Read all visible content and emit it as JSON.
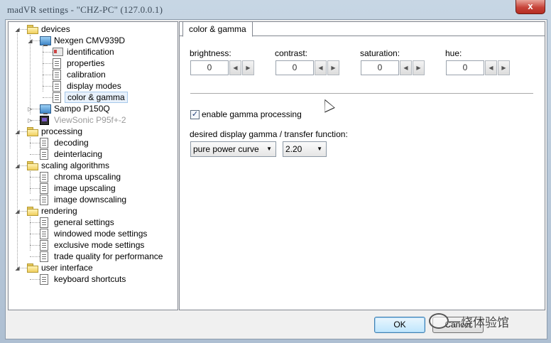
{
  "window": {
    "title": "madVR settings - \"CHZ-PC\" (127.0.0.1)",
    "close_glyph": "x"
  },
  "tree": {
    "items": [
      {
        "label": "devices",
        "icon": "folder-icon",
        "level": 0
      },
      {
        "label": "Nexgen CMV939D",
        "icon": "monitor-icon",
        "level": 1
      },
      {
        "label": "identification",
        "icon": "id-card-icon",
        "level": 2
      },
      {
        "label": "properties",
        "icon": "document-icon",
        "level": 2
      },
      {
        "label": "calibration",
        "icon": "document-icon",
        "level": 2
      },
      {
        "label": "display modes",
        "icon": "document-icon",
        "level": 2
      },
      {
        "label": "color & gamma",
        "icon": "document-icon",
        "level": 2,
        "selected": true
      },
      {
        "label": "Sampo P150Q",
        "icon": "monitor-icon",
        "level": 1
      },
      {
        "label": "ViewSonic P95f+-2",
        "icon": "tv-icon",
        "level": 1,
        "disabled": true
      },
      {
        "label": "processing",
        "icon": "folder-icon",
        "level": 0
      },
      {
        "label": "decoding",
        "icon": "document-icon",
        "level": 1
      },
      {
        "label": "deinterlacing",
        "icon": "document-icon",
        "level": 1
      },
      {
        "label": "scaling algorithms",
        "icon": "folder-icon",
        "level": 0
      },
      {
        "label": "chroma upscaling",
        "icon": "document-icon",
        "level": 1
      },
      {
        "label": "image upscaling",
        "icon": "document-icon",
        "level": 1
      },
      {
        "label": "image downscaling",
        "icon": "document-icon",
        "level": 1
      },
      {
        "label": "rendering",
        "icon": "folder-icon",
        "level": 0
      },
      {
        "label": "general settings",
        "icon": "document-icon",
        "level": 1
      },
      {
        "label": "windowed mode settings",
        "icon": "document-icon",
        "level": 1
      },
      {
        "label": "exclusive mode settings",
        "icon": "document-icon",
        "level": 1
      },
      {
        "label": "trade quality for performance",
        "icon": "document-icon",
        "level": 1
      },
      {
        "label": "user interface",
        "icon": "folder-icon",
        "level": 0
      },
      {
        "label": "keyboard shortcuts",
        "icon": "document-icon",
        "level": 1
      }
    ]
  },
  "panel": {
    "tab_label": "color & gamma",
    "fields": [
      {
        "label": "brightness:",
        "value": "0"
      },
      {
        "label": "contrast:",
        "value": "0"
      },
      {
        "label": "saturation:",
        "value": "0"
      },
      {
        "label": "hue:",
        "value": "0"
      }
    ],
    "gamma_checkbox": {
      "label": "enable gamma processing",
      "checked": true
    },
    "gamma_label": "desired display gamma / transfer function:",
    "curve_select": {
      "value": "pure power curve"
    },
    "gamma_select": {
      "value": "2.20"
    }
  },
  "buttons": {
    "ok": "OK",
    "cancel": "Cancel"
  },
  "watermark": {
    "text": "一烧体验馆"
  }
}
